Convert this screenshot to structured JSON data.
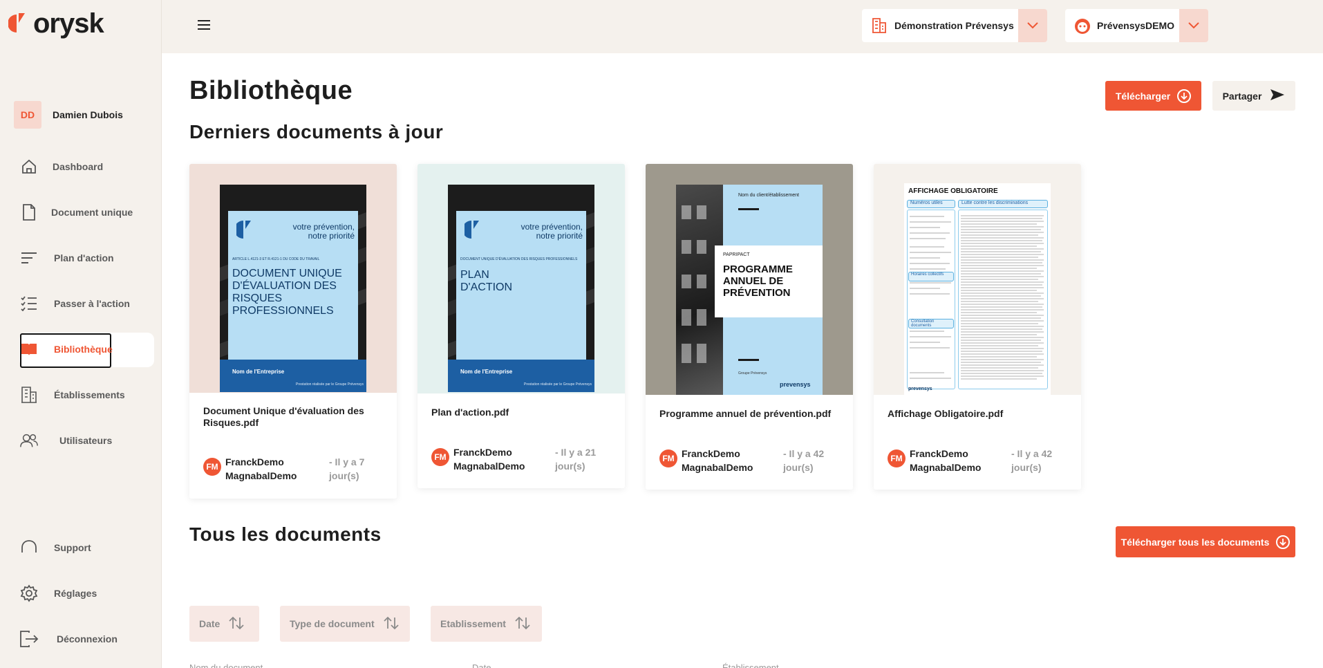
{
  "brand": {
    "name": "orysk",
    "accent": "#ef5634"
  },
  "user": {
    "initials": "DD",
    "name": "Damien Dubois"
  },
  "nav": {
    "dashboard": "Dashboard",
    "document_unique": "Document unique",
    "plan_action": "Plan d'action",
    "passer_action": "Passer à l'action",
    "bibliotheque": "Bibliothèque",
    "etablissements": "Établissements",
    "utilisateurs": "Utilisateurs",
    "support": "Support",
    "reglages": "Réglages",
    "deconnexion": "Déconnexion"
  },
  "topbar": {
    "org_selector": "Démonstration Prévensys",
    "account_selector": "PrévensysDEMO"
  },
  "page": {
    "title": "Bibliothèque",
    "recent_title": "Derniers documents à jour",
    "all_title": "Tous les documents",
    "download_label": "Télécharger",
    "share_label": "Partager",
    "download_all_label": "Télécharger tous les documents"
  },
  "cards": [
    {
      "file": "Document Unique d'évaluation des Risques.pdf",
      "author_initials": "FM",
      "author": "FranckDemo MagnabalDemo",
      "time": "- Il y a 7 jour(s)",
      "cover": {
        "top_line": "ARTICLE L.4121-3 ET R.4121-1 DU CODE DU TRAVAIL",
        "tagline": "votre prévention, notre priorité",
        "title": "DOCUMENT UNIQUE D'ÉVALUATION DES RISQUES PROFESSIONNELS",
        "company": "Nom de l'Entreprise",
        "footer": "Prestation réalisée par le Groupe Prévensys"
      }
    },
    {
      "file": "Plan d'action.pdf",
      "author_initials": "FM",
      "author": "FranckDemo MagnabalDemo",
      "time": "- Il y a 21 jour(s)",
      "cover": {
        "top_line": "DOCUMENT UNIQUE D'ÉVALUATION DES RISQUES PROFESSIONNELS",
        "tagline": "votre prévention, notre priorité",
        "title": "PLAN D'ACTION",
        "company": "Nom de l'Entreprise",
        "footer": "Prestation réalisée par le Groupe Prévensys"
      }
    },
    {
      "file": "Programme annuel de prévention.pdf",
      "author_initials": "FM",
      "author": "FranckDemo MagnabalDemo",
      "time": "- Il y a 42 jour(s)",
      "cover": {
        "top_line": "Nom du client/établissement",
        "kicker": "PAPRIPACT",
        "title": "PROGRAMME ANNUEL DE PRÉVENTION",
        "small": "Groupe Prévensys",
        "brand": "prevensys"
      }
    },
    {
      "file": "Affichage Obligatoire.pdf",
      "author_initials": "FM",
      "author": "FranckDemo MagnabalDemo",
      "time": "- Il y a 42 jour(s)",
      "cover": {
        "title": "AFFICHAGE OBLIGATOIRE",
        "box1": "Numéros utiles",
        "box2": "Lutte contre les discriminations",
        "box3": "Horaires collectifs",
        "box4": "Consultation documents",
        "brand": "prevensys"
      }
    }
  ],
  "filters": {
    "date": "Date",
    "type": "Type de document",
    "etablissement": "Etablissement"
  },
  "table_headers": [
    "Nom du document",
    "Date",
    "Établissement"
  ]
}
